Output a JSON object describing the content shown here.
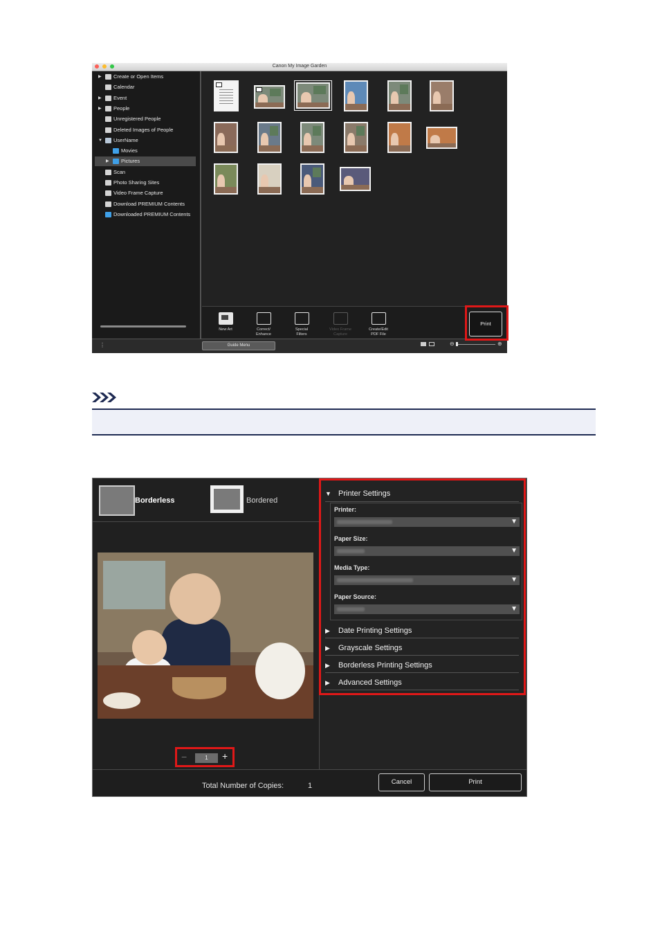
{
  "window1": {
    "title": "Canon My Image Garden",
    "traffic_lights": [
      "#fc5f57",
      "#fdbc2e",
      "#33c748"
    ],
    "sidebar": {
      "items": [
        {
          "label": "Create or Open Items",
          "icon": "create-icon",
          "expandable": true
        },
        {
          "label": "Calendar",
          "icon": "calendar-icon",
          "expandable": false
        },
        {
          "label": "Event",
          "icon": "event-icon",
          "expandable": true
        },
        {
          "label": "People",
          "icon": "person-icon",
          "expandable": true
        },
        {
          "label": "Unregistered People",
          "icon": "person-icon",
          "expandable": false
        },
        {
          "label": "Deleted Images of People",
          "icon": "person-outline-icon",
          "expandable": false
        },
        {
          "label": "UserName",
          "icon": "computer-icon",
          "expandable": true,
          "expanded": true
        },
        {
          "label": "Movies",
          "icon": "folder-icon",
          "expandable": false,
          "indent": true
        },
        {
          "label": "Pictures",
          "icon": "folder-icon",
          "expandable": true,
          "indent": true,
          "selected": true
        },
        {
          "label": "Scan",
          "icon": "scan-icon",
          "expandable": false
        },
        {
          "label": "Photo Sharing Sites",
          "icon": "photo-sharing-icon",
          "expandable": false
        },
        {
          "label": "Video Frame Capture",
          "icon": "video-frame-icon",
          "expandable": false
        },
        {
          "label": "Download PREMIUM Contents",
          "icon": "download-icon",
          "expandable": false
        },
        {
          "label": "Downloaded PREMIUM Contents",
          "icon": "folder-icon",
          "expandable": false
        }
      ]
    },
    "toolbar": {
      "tools": [
        {
          "label_line1": "New Art",
          "label_line2": "",
          "icon": "new-art-icon",
          "state": "active"
        },
        {
          "label_line1": "Correct/",
          "label_line2": "Enhance",
          "icon": "correct-enhance-icon",
          "state": "normal"
        },
        {
          "label_line1": "Special",
          "label_line2": "Filters",
          "icon": "special-filters-icon",
          "state": "normal"
        },
        {
          "label_line1": "Video Frame",
          "label_line2": "Capture",
          "icon": "video-frame-capture-icon",
          "state": "disabled"
        },
        {
          "label_line1": "Create/Edit",
          "label_line2": "PDF File",
          "icon": "pdf-icon",
          "state": "normal"
        }
      ],
      "print_label": "Print"
    },
    "statusbar": {
      "guide_menu_label": "Guide Menu"
    }
  },
  "note": {
    "icon": "note-icon"
  },
  "print_dialog": {
    "layouts": [
      {
        "label": "Borderless",
        "selected": true
      },
      {
        "label": "Bordered",
        "selected": false
      }
    ],
    "copies": {
      "minus": "−",
      "value": "1",
      "plus": "+"
    },
    "printer_settings": {
      "title": "Printer Settings",
      "fields": [
        {
          "label": "Printer:"
        },
        {
          "label": "Paper Size:"
        },
        {
          "label": "Media Type:"
        },
        {
          "label": "Paper Source:"
        }
      ]
    },
    "collapsed_sections": [
      "Date Printing Settings",
      "Grayscale Settings",
      "Borderless Printing Settings",
      "Advanced Settings"
    ],
    "footer": {
      "total_label": "Total Number of Copies:",
      "total_value": "1",
      "cancel_label": "Cancel",
      "print_label": "Print"
    }
  },
  "colors": {
    "highlight": "#e01818",
    "note_rule": "#1e2a52"
  }
}
